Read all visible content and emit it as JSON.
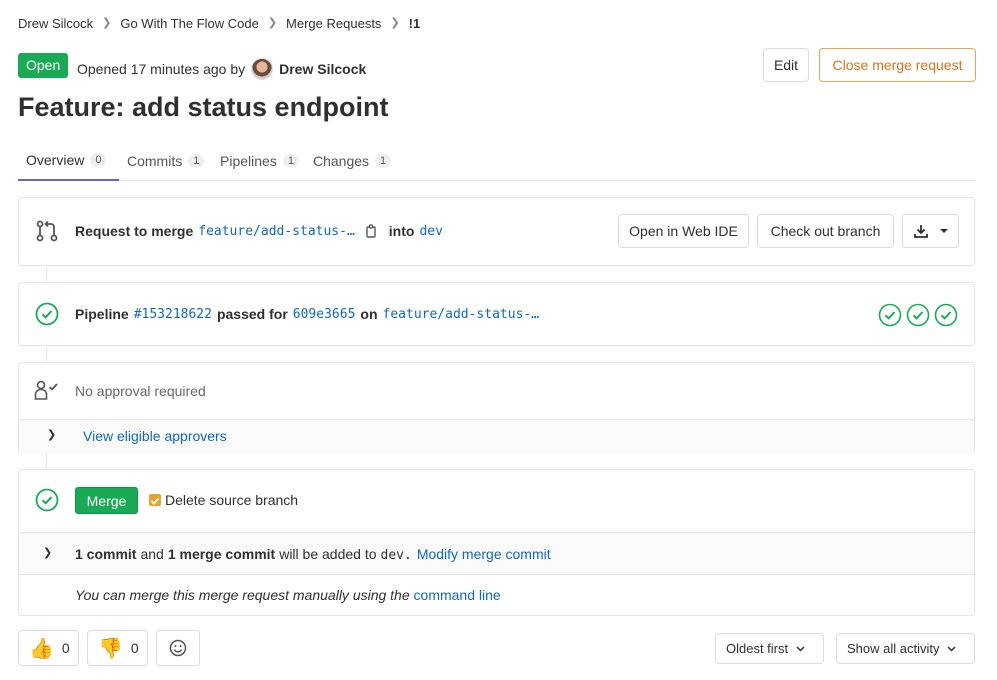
{
  "breadcrumb": [
    "Drew Silcock",
    "Go With The Flow Code",
    "Merge Requests",
    "!1"
  ],
  "header": {
    "status": "Open",
    "opened_text": "Opened 17 minutes ago by",
    "author": "Drew Silcock",
    "edit_label": "Edit",
    "close_label": "Close merge request",
    "title": "Feature: add status endpoint"
  },
  "tabs": [
    {
      "label": "Overview",
      "count": "0"
    },
    {
      "label": "Commits",
      "count": "1"
    },
    {
      "label": "Pipelines",
      "count": "1"
    },
    {
      "label": "Changes",
      "count": "1"
    }
  ],
  "merge_request": {
    "prefix": "Request to merge",
    "source_branch": "feature/add-status-…",
    "into": "into",
    "target_branch": "dev",
    "open_web_ide": "Open in Web IDE",
    "checkout_branch": "Check out branch"
  },
  "pipeline": {
    "label": "Pipeline",
    "id": "#153218622",
    "passed_for": "passed for",
    "commit": "609e3665",
    "on": "on",
    "branch": "feature/add-status-…",
    "stages": [
      "passed",
      "passed",
      "passed"
    ]
  },
  "approvals": {
    "text": "No approval required",
    "view_approvers": "View eligible approvers"
  },
  "merge": {
    "button": "Merge",
    "delete_source": "Delete source branch",
    "commits_a": "1 commit",
    "and": "and",
    "commits_b": "1 merge commit",
    "will_be_added": "will be added to",
    "target": "dev.",
    "modify": "Modify merge commit",
    "manual_text": "You can merge this merge request manually using the",
    "command_line": "command line"
  },
  "reactions": {
    "thumbs_up": "0",
    "thumbs_down": "0"
  },
  "sort": {
    "order": "Oldest first",
    "filter": "Show all activity"
  },
  "colors": {
    "success": "#1aaa55",
    "link": "#1068bf",
    "close_button": "#e0701a",
    "tab_active": "#6666c4"
  }
}
